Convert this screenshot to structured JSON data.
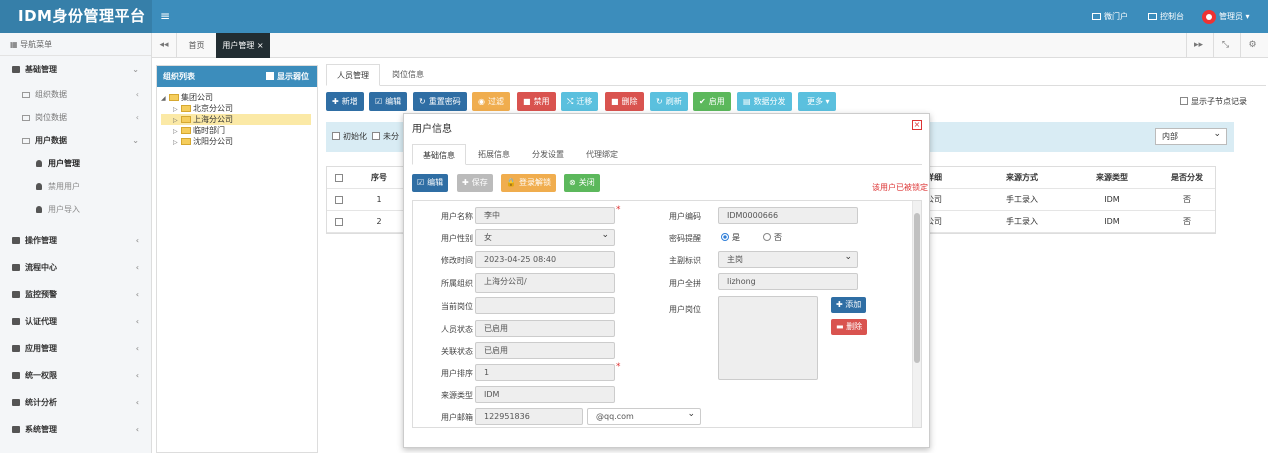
{
  "app": {
    "title": "IDM身份管理平台",
    "menu_toggle": "≡"
  },
  "header": {
    "portal": "微门户",
    "console": "控制台",
    "user": "管理员 ▾"
  },
  "sidebar": {
    "title": "导航菜单",
    "groups": [
      {
        "label": "基础管理",
        "arrow": "⌄"
      },
      {
        "label": "操作管理",
        "arrow": "‹"
      },
      {
        "label": "流程中心",
        "arrow": "‹"
      },
      {
        "label": "监控预警",
        "arrow": "‹"
      },
      {
        "label": "认证代理",
        "arrow": "‹"
      },
      {
        "label": "应用管理",
        "arrow": "‹"
      },
      {
        "label": "统一权限",
        "arrow": "‹"
      },
      {
        "label": "统计分析",
        "arrow": "‹"
      },
      {
        "label": "系统管理",
        "arrow": "‹"
      }
    ],
    "subs": [
      {
        "label": "组织数据",
        "arrow": "‹"
      },
      {
        "label": "岗位数据",
        "arrow": "‹"
      },
      {
        "label": "用户数据",
        "arrow": "⌄"
      }
    ],
    "leaves": [
      "用户管理",
      "禁用用户",
      "用户导入"
    ]
  },
  "tabs": {
    "prev": "◂◂",
    "home": "首页",
    "active": "用户管理 ×",
    "next": "▸▸",
    "fullscreen": "⤡",
    "settings": "⚙"
  },
  "org": {
    "title": "组织列表",
    "show_disabled": "显示弱位",
    "nodes": [
      "集团公司",
      "北京分公司",
      "上海分公司",
      "临时部门",
      "沈阳分公司"
    ]
  },
  "main": {
    "tabs": [
      "人员管理",
      "岗位信息"
    ],
    "toolbar": [
      {
        "icon": "✚",
        "label": "新增",
        "color": "#2f6ea4"
      },
      {
        "icon": "☑",
        "label": "编辑",
        "color": "#2f6ea4"
      },
      {
        "icon": "↻",
        "label": "重置密码",
        "color": "#2f6ea4"
      },
      {
        "icon": "◉",
        "label": "过滤",
        "color": "#f0ad4e"
      },
      {
        "icon": "■",
        "label": "禁用",
        "color": "#d9534f"
      },
      {
        "icon": "⤭",
        "label": "迁移",
        "color": "#5bc0de"
      },
      {
        "icon": "■",
        "label": "删除",
        "color": "#d9534f"
      },
      {
        "icon": "↻",
        "label": "刷新",
        "color": "#5bc0de"
      },
      {
        "icon": "✔",
        "label": "启用",
        "color": "#5cb85c"
      },
      {
        "icon": "▤",
        "label": "数据分发",
        "color": "#5bc0de"
      },
      {
        "icon": "",
        "label": "更多 ▾",
        "color": "#5bc0de"
      }
    ],
    "show_child": "显示子节点记录",
    "filters": [
      "初始化",
      "未分"
    ],
    "scope": "内部",
    "grid": {
      "headers": [
        "序号",
        "详细",
        "来源方式",
        "来源类型",
        "是否分发"
      ],
      "rows": [
        [
          "1",
          "公司",
          "手工录入",
          "IDM",
          "否"
        ],
        [
          "2",
          "公司",
          "手工录入",
          "IDM",
          "否"
        ]
      ]
    }
  },
  "modal": {
    "title": "用户信息",
    "close": "×",
    "tabs": [
      "基础信息",
      "拓展信息",
      "分发设置",
      "代理绑定"
    ],
    "buttons": [
      {
        "icon": "☑",
        "label": "编辑",
        "color": "#2f6ea4"
      },
      {
        "icon": "✚",
        "label": "保存",
        "color": "#bbbbbb"
      },
      {
        "icon": "🔒",
        "label": "登录解锁",
        "color": "#f0ad4e"
      },
      {
        "icon": "⊗",
        "label": "关闭",
        "color": "#5cb85c"
      }
    ],
    "lock_msg": "该用户已被锁定",
    "labels": {
      "name": "用户名称",
      "gender": "用户性别",
      "modified": "修改时间",
      "org": "所属组织",
      "position": "当前岗位",
      "status": "人员状态",
      "assoc": "关联状态",
      "order": "用户排序",
      "source": "来源类型",
      "email": "用户邮箱",
      "code": "用户编码",
      "pwd_remind": "密码提醒",
      "main_flag": "主副标识",
      "pinyin": "用户全拼",
      "user_pos": "用户岗位"
    },
    "values": {
      "name": "李中",
      "gender": "女",
      "modified": "2023-04-25 08:40",
      "org": "上海分公司/",
      "position": "",
      "status": "已启用",
      "assoc": "已启用",
      "order": "1",
      "source": "IDM",
      "email": "122951836",
      "email_domain": "@qq.com",
      "code": "IDM0000666",
      "yes": "是",
      "no": "否",
      "main_flag": "主岗",
      "pinyin": "lizhong"
    },
    "pos_add": "✚ 添加",
    "pos_del": "▬ 删除"
  }
}
